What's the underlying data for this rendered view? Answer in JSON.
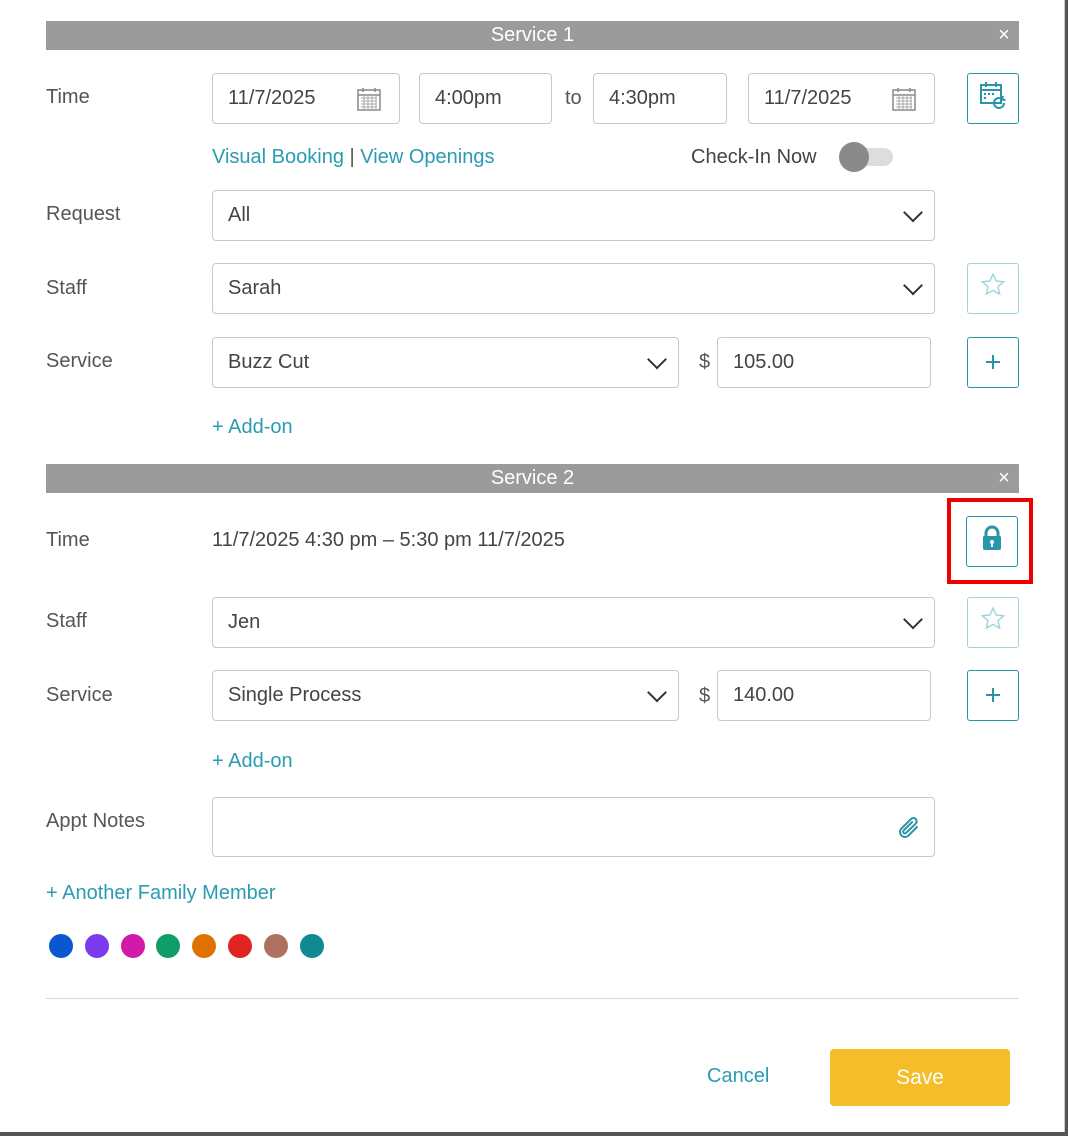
{
  "service1": {
    "title": "Service 1",
    "close": "×",
    "time_label": "Time",
    "start_date": "11/7/2025",
    "start_time": "4:00pm",
    "to_label": "to",
    "end_time": "4:30pm",
    "end_date": "11/7/2025",
    "visual_booking": "Visual Booking",
    "separator": "|",
    "view_openings": "View Openings",
    "checkin_label": "Check-In Now",
    "checkin_on": false,
    "request_label": "Request",
    "request_value": "All",
    "staff_label": "Staff",
    "staff_value": "Sarah",
    "service_label": "Service",
    "service_value": "Buzz Cut",
    "currency": "$",
    "price": "105.00",
    "addon": "+ Add-on"
  },
  "service2": {
    "title": "Service 2",
    "close": "×",
    "time_label": "Time",
    "time_text": "11/7/2025 4:30 pm – 5:30 pm 11/7/2025",
    "staff_label": "Staff",
    "staff_value": "Jen",
    "service_label": "Service",
    "service_value": "Single Process",
    "currency": "$",
    "price": "140.00",
    "addon": "+ Add-on"
  },
  "notes": {
    "label": "Appt Notes",
    "value": ""
  },
  "another_member": "+ Another Family Member",
  "colors": [
    "#0b57d0",
    "#7c3aed",
    "#d01aa8",
    "#0f9d6a",
    "#e07000",
    "#e02424",
    "#b07060",
    "#0e8a90"
  ],
  "accent_color": "#2a94a8",
  "highlight_color": "#ee0000",
  "footer": {
    "cancel": "Cancel",
    "save": "Save"
  }
}
